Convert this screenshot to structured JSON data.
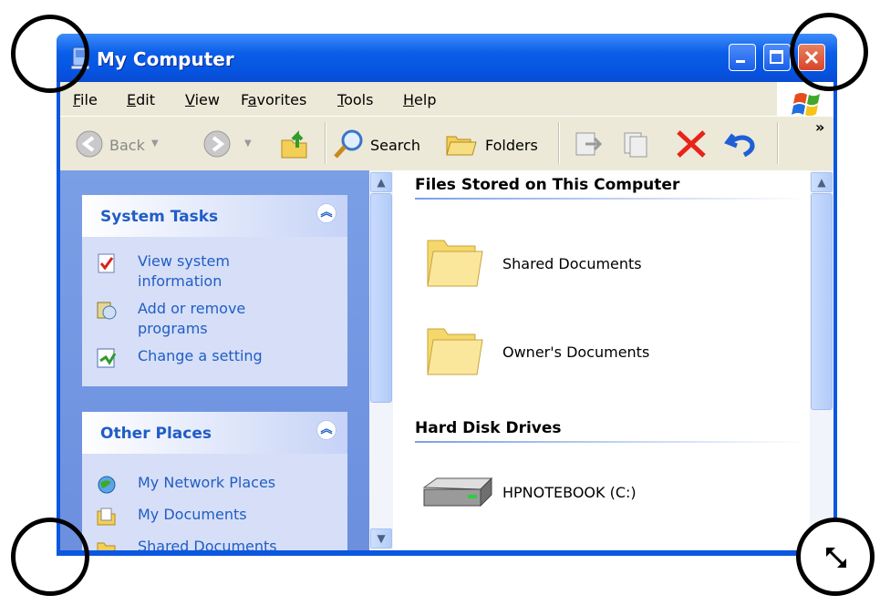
{
  "window": {
    "title": "My Computer"
  },
  "menubar": {
    "items": [
      {
        "label": "File",
        "u": "F",
        "rest": "ile"
      },
      {
        "label": "Edit",
        "u": "E",
        "rest": "dit"
      },
      {
        "label": "View",
        "u": "V",
        "rest": "iew"
      },
      {
        "pre": "F",
        "u": "a",
        "rest": "vorites",
        "label": "Favorites"
      },
      {
        "label": "Tools",
        "u": "T",
        "rest": "ools"
      },
      {
        "label": "Help",
        "u": "H",
        "rest": "elp"
      }
    ]
  },
  "toolbar": {
    "back_label": "Back",
    "search_label": "Search",
    "folders_label": "Folders",
    "overflow": "»"
  },
  "left": {
    "system_tasks": {
      "title": "System Tasks",
      "items": [
        "View system\ninformation",
        "Add or remove\nprograms",
        "Change a setting"
      ]
    },
    "other_places": {
      "title": "Other Places",
      "items": [
        "My Network Places",
        "My Documents",
        "Shared Documents"
      ]
    }
  },
  "main": {
    "section1": "Files Stored on This Computer",
    "folders": [
      "Shared Documents",
      "Owner's Documents"
    ],
    "section2": "Hard Disk Drives",
    "drives": [
      "HPNOTEBOOK (C:)"
    ]
  },
  "colors": {
    "titlebar": "#0a5ee8",
    "task_link": "#215dc6",
    "close": "#d8452a"
  }
}
